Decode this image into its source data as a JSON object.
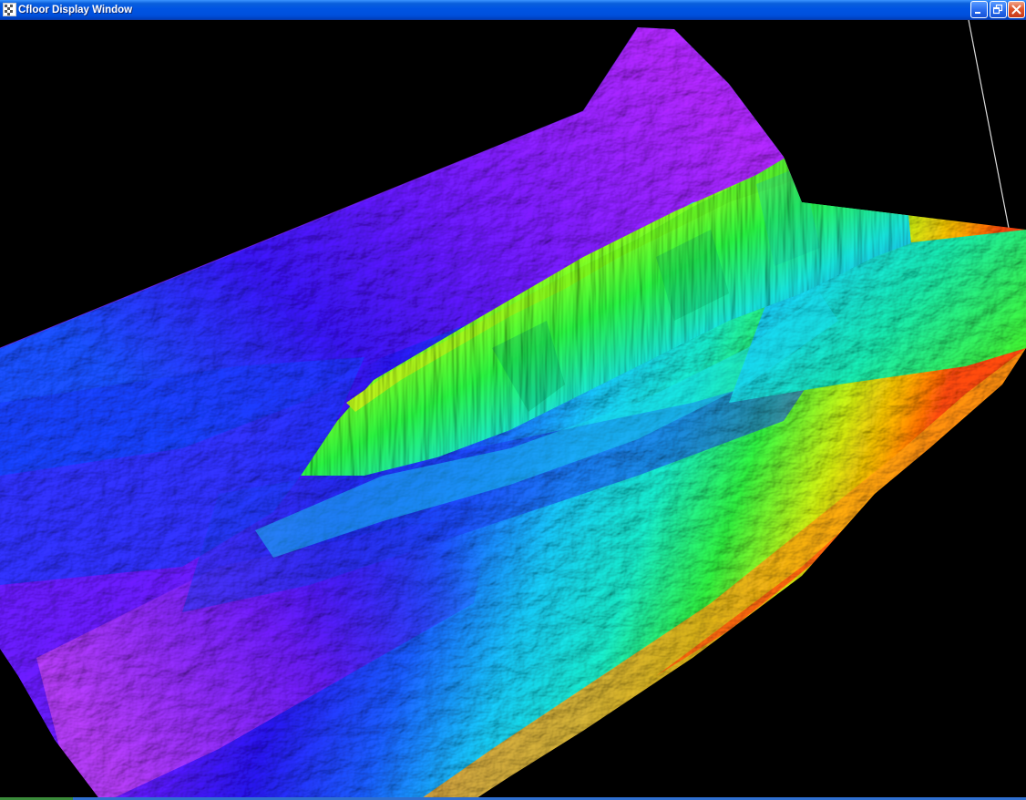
{
  "window": {
    "title": "Cfloor Display Window",
    "icon": "app-icon",
    "controls": [
      {
        "name": "minimize",
        "icon": "minimize-icon"
      },
      {
        "name": "restore",
        "icon": "restore-icon"
      },
      {
        "name": "close",
        "icon": "close-icon"
      }
    ]
  },
  "scene": {
    "type": "3d-seafloor-bathymetry-surface",
    "background": "#000000",
    "colormap": [
      "#8a18ff",
      "#2a10f5",
      "#1a6cff",
      "#15e8f0",
      "#1aff40",
      "#b4ff1a",
      "#ffb000",
      "#ff4a0a"
    ]
  },
  "colors": {
    "titlebar": "#0054e3",
    "close_button": "#e0552a"
  }
}
